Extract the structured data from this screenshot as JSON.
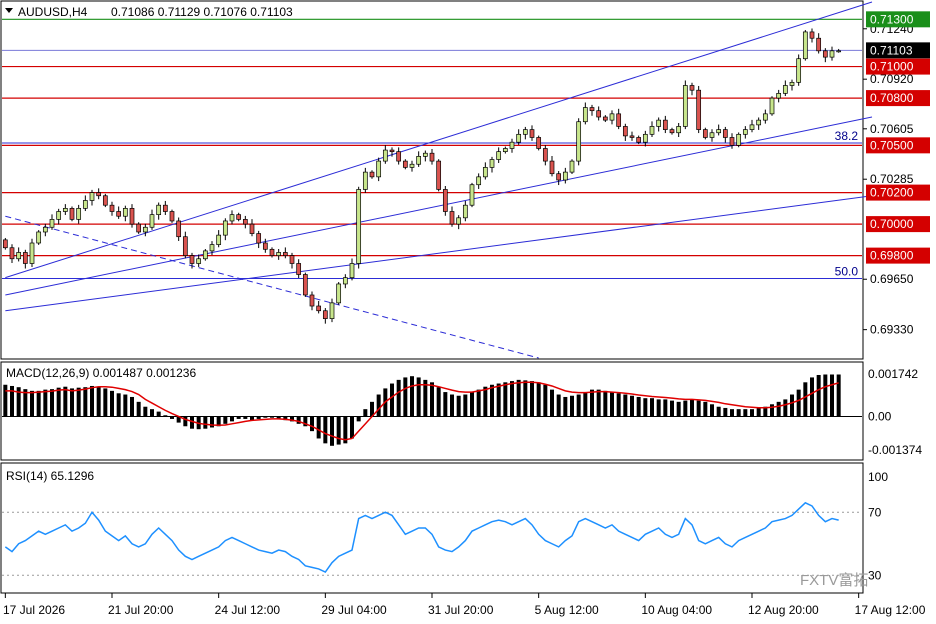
{
  "header": {
    "symbol": "AUDUSD,H4",
    "ohlc": "0.71086 0.71129 0.71076 0.71103"
  },
  "watermark": "FXTV富拓",
  "colors": {
    "background": "#ffffff",
    "axis": "#000000",
    "bull_candle": "#c8e68c",
    "bear_candle": "#d9534f",
    "wick": "#000000",
    "resistance_line": "#d40000",
    "top_line": "#1a8f1a",
    "channel_line": "#2c2cd6",
    "macd_hist": "#000000",
    "macd_signal": "#e00000",
    "rsi_line": "#1e90ff",
    "current_price_box": "#000000"
  },
  "chart_data": [
    {
      "type": "candlestick",
      "pane": "price",
      "ylim": [
        0.6915,
        0.7141
      ],
      "price_axis_labels": [
        "0.71240",
        "0.70920",
        "0.70605",
        "0.70285",
        "0.69650",
        "0.69330"
      ],
      "price_axis_values": [
        0.7124,
        0.7092,
        0.70605,
        0.70285,
        0.6965,
        0.6933
      ],
      "horizontal_levels": [
        {
          "label": "0.71300",
          "value": 0.713,
          "color": "#1a8f1a"
        },
        {
          "label": "0.71000",
          "value": 0.71,
          "color": "#d40000"
        },
        {
          "label": "0.70800",
          "value": 0.708,
          "color": "#d40000"
        },
        {
          "label": "0.70500",
          "value": 0.705,
          "color": "#d40000"
        },
        {
          "label": "0.70200",
          "value": 0.702,
          "color": "#d40000"
        },
        {
          "label": "0.70000",
          "value": 0.7,
          "color": "#d40000"
        },
        {
          "label": "0.69800",
          "value": 0.698,
          "color": "#d40000"
        }
      ],
      "fib_levels": [
        {
          "label": "38.2",
          "value": 0.70515
        },
        {
          "label": "50.0",
          "value": 0.69655
        }
      ],
      "current_price": {
        "label": "0.71103",
        "value": 0.71103
      },
      "x_axis_labels": [
        "17 Jul 2026",
        "21 Jul 20:00",
        "24 Jul 12:00",
        "29 Jul 04:00",
        "31 Jul 20:00",
        "5 Aug 12:00",
        "10 Aug 04:00",
        "12 Aug 20:00",
        "17 Aug 12:00"
      ],
      "x_axis_bar_index": [
        0,
        16,
        32,
        48,
        64,
        80,
        96,
        112,
        128
      ],
      "trendlines": [
        {
          "style": "solid",
          "from": [
            0,
            0.6966
          ],
          "to": [
            130,
            0.7141
          ]
        },
        {
          "style": "solid",
          "from": [
            0,
            0.6955
          ],
          "to": [
            130,
            0.7068
          ]
        },
        {
          "style": "solid",
          "from": [
            0,
            0.6945
          ],
          "to": [
            130,
            0.7018
          ]
        },
        {
          "style": "dashed",
          "from": [
            0,
            0.7005
          ],
          "to": [
            80,
            0.6915
          ]
        }
      ],
      "close": [
        0.6985,
        0.6978,
        0.6982,
        0.6975,
        0.6988,
        0.6995,
        0.6998,
        0.7003,
        0.7008,
        0.701,
        0.7003,
        0.701,
        0.7015,
        0.702,
        0.7018,
        0.7012,
        0.7008,
        0.7005,
        0.701,
        0.7,
        0.6995,
        0.6998,
        0.7006,
        0.7012,
        0.7008,
        0.7002,
        0.6992,
        0.698,
        0.6975,
        0.6978,
        0.6983,
        0.6987,
        0.6993,
        0.7002,
        0.7006,
        0.7003,
        0.7,
        0.6994,
        0.6988,
        0.6984,
        0.698,
        0.6982,
        0.698,
        0.6975,
        0.6968,
        0.6955,
        0.6948,
        0.6945,
        0.694,
        0.695,
        0.6962,
        0.6966,
        0.6975,
        0.7022,
        0.7033,
        0.703,
        0.704,
        0.7047,
        0.7046,
        0.704,
        0.7036,
        0.7038,
        0.7043,
        0.7045,
        0.704,
        0.7022,
        0.7008,
        0.7,
        0.7004,
        0.7012,
        0.7025,
        0.703,
        0.7036,
        0.7041,
        0.7046,
        0.7048,
        0.7052,
        0.7057,
        0.706,
        0.7055,
        0.7048,
        0.704,
        0.7032,
        0.7028,
        0.7033,
        0.704,
        0.7065,
        0.7074,
        0.7072,
        0.7068,
        0.7066,
        0.707,
        0.7062,
        0.7056,
        0.7055,
        0.7052,
        0.7057,
        0.7062,
        0.7066,
        0.706,
        0.7058,
        0.7062,
        0.7088,
        0.7085,
        0.706,
        0.7055,
        0.7058,
        0.706,
        0.7055,
        0.705,
        0.7057,
        0.706,
        0.7063,
        0.7066,
        0.707,
        0.708,
        0.7083,
        0.7088,
        0.709,
        0.7105,
        0.7122,
        0.7118,
        0.711,
        0.7106,
        0.711,
        0.711
      ],
      "open": [
        0.699,
        0.6985,
        0.6978,
        0.6982,
        0.6975,
        0.6988,
        0.6995,
        0.6998,
        0.7003,
        0.7008,
        0.701,
        0.7003,
        0.701,
        0.7015,
        0.702,
        0.7018,
        0.7012,
        0.7008,
        0.7005,
        0.701,
        0.7,
        0.6995,
        0.6998,
        0.7006,
        0.7012,
        0.7008,
        0.7002,
        0.6992,
        0.698,
        0.6975,
        0.6978,
        0.6983,
        0.6987,
        0.6993,
        0.7002,
        0.7006,
        0.7003,
        0.7,
        0.6994,
        0.6988,
        0.6984,
        0.698,
        0.6982,
        0.698,
        0.6975,
        0.6968,
        0.6955,
        0.6948,
        0.6945,
        0.694,
        0.695,
        0.6962,
        0.6966,
        0.6975,
        0.7022,
        0.7033,
        0.703,
        0.704,
        0.7047,
        0.7046,
        0.704,
        0.7036,
        0.7038,
        0.7043,
        0.7045,
        0.704,
        0.7022,
        0.7008,
        0.7,
        0.7004,
        0.7012,
        0.7025,
        0.703,
        0.7036,
        0.7041,
        0.7046,
        0.7048,
        0.7052,
        0.7057,
        0.706,
        0.7055,
        0.7048,
        0.704,
        0.7032,
        0.7028,
        0.7033,
        0.704,
        0.7065,
        0.7074,
        0.7072,
        0.7068,
        0.7066,
        0.707,
        0.7062,
        0.7056,
        0.7055,
        0.7052,
        0.7057,
        0.7062,
        0.7066,
        0.706,
        0.7058,
        0.7062,
        0.7088,
        0.7085,
        0.706,
        0.7055,
        0.7058,
        0.706,
        0.7055,
        0.705,
        0.7057,
        0.706,
        0.7063,
        0.7066,
        0.707,
        0.708,
        0.7083,
        0.7088,
        0.709,
        0.7105,
        0.7122,
        0.7118,
        0.711,
        0.7106,
        0.711
      ]
    },
    {
      "type": "macd",
      "pane": "macd",
      "label": "MACD(12,26,9) 0.001487 0.001236",
      "ylim": [
        -0.0017,
        0.00215
      ],
      "axis_labels": [
        "0.001742",
        "0.00",
        "-0.001374"
      ],
      "axis_values": [
        0.001742,
        0.0,
        -0.001374
      ],
      "histogram": [
        0.0013,
        0.00125,
        0.0012,
        0.00112,
        0.00105,
        0.00105,
        0.0011,
        0.00112,
        0.00118,
        0.00122,
        0.00115,
        0.00118,
        0.0012,
        0.00125,
        0.00122,
        0.00115,
        0.00105,
        0.00095,
        0.0009,
        0.0008,
        0.0006,
        0.0004,
        0.0003,
        0.0002,
        5e-05,
        -0.0001,
        -0.00025,
        -0.0004,
        -0.0005,
        -0.00052,
        -0.0005,
        -0.00045,
        -0.0004,
        -0.0003,
        -0.0002,
        -0.0001,
        -0.0001,
        -0.00015,
        -0.0001,
        -5e-05,
        -5e-05,
        -0.0001,
        -0.00015,
        -0.0002,
        -0.0003,
        -0.0004,
        -0.0006,
        -0.0009,
        -0.0011,
        -0.0012,
        -0.00115,
        -0.0011,
        -0.0009,
        -0.0002,
        0.0003,
        0.0006,
        0.0009,
        0.00115,
        0.00135,
        0.0015,
        0.0016,
        0.00165,
        0.0016,
        0.0015,
        0.0014,
        0.0012,
        0.001,
        0.0009,
        0.00085,
        0.0009,
        0.001,
        0.0011,
        0.00122,
        0.0013,
        0.00135,
        0.0014,
        0.00145,
        0.0015,
        0.00148,
        0.00145,
        0.0014,
        0.0013,
        0.0011,
        0.0009,
        0.0008,
        0.00085,
        0.0009,
        0.001,
        0.0011,
        0.0011,
        0.00105,
        0.001,
        0.00095,
        0.0009,
        0.00085,
        0.0008,
        0.00075,
        0.00075,
        0.0007,
        0.0007,
        0.00065,
        0.0006,
        0.00065,
        0.0007,
        0.00065,
        0.0006,
        0.0005,
        0.0004,
        0.00035,
        0.0003,
        0.0003,
        0.0003,
        0.0003,
        0.00035,
        0.0004,
        0.0005,
        0.0006,
        0.0007,
        0.0009,
        0.0011,
        0.0014,
        0.0016,
        0.0017,
        0.00172,
        0.00172,
        0.00172
      ],
      "signal": [
        0.00105,
        0.00105,
        0.001,
        0.00098,
        0.00098,
        0.001,
        0.00102,
        0.00104,
        0.00108,
        0.0011,
        0.00105,
        0.00108,
        0.00112,
        0.00118,
        0.00122,
        0.00122,
        0.0012,
        0.00115,
        0.0011,
        0.00102,
        0.0009,
        0.0007,
        0.00055,
        0.0004,
        0.00025,
        0.00012,
        0.0,
        -0.00012,
        -0.0002,
        -0.00028,
        -0.00032,
        -0.00035,
        -0.00036,
        -0.00035,
        -0.0003,
        -0.00025,
        -0.0002,
        -0.00016,
        -0.00014,
        -0.00012,
        -0.0001,
        -0.0001,
        -0.00012,
        -0.00015,
        -0.0002,
        -0.0003,
        -0.0004,
        -0.00055,
        -0.0007,
        -0.0008,
        -0.0009,
        -0.00095,
        -0.0009,
        -0.0006,
        -0.0003,
        0.0,
        0.0003,
        0.0006,
        0.0008,
        0.001,
        0.00115,
        0.00125,
        0.0013,
        0.0013,
        0.00128,
        0.00122,
        0.00115,
        0.00108,
        0.00102,
        0.001,
        0.001,
        0.00105,
        0.0011,
        0.00118,
        0.00124,
        0.0013,
        0.00135,
        0.00138,
        0.0014,
        0.0014,
        0.00138,
        0.00132,
        0.00125,
        0.00115,
        0.00105,
        0.001,
        0.00098,
        0.00098,
        0.001,
        0.00102,
        0.00102,
        0.001,
        0.00098,
        0.00095,
        0.00092,
        0.00088,
        0.00085,
        0.00082,
        0.0008,
        0.00078,
        0.00075,
        0.00072,
        0.0007,
        0.0007,
        0.00068,
        0.00066,
        0.00062,
        0.00058,
        0.00052,
        0.00048,
        0.00044,
        0.0004,
        0.00038,
        0.00036,
        0.00036,
        0.00038,
        0.00042,
        0.00048,
        0.00056,
        0.00066,
        0.0008,
        0.00095,
        0.0011,
        0.00122,
        0.0013,
        0.00138
      ]
    },
    {
      "type": "line",
      "pane": "rsi",
      "label": "RSI(14) 65.1296",
      "ylim": [
        20,
        100
      ],
      "axis_labels": [
        "100",
        "70",
        "30"
      ],
      "axis_values": [
        100,
        70,
        30
      ],
      "values": [
        48,
        45,
        50,
        52,
        55,
        58,
        56,
        58,
        60,
        62,
        58,
        60,
        63,
        70,
        65,
        58,
        55,
        52,
        55,
        50,
        48,
        50,
        56,
        60,
        56,
        52,
        46,
        42,
        40,
        42,
        44,
        46,
        48,
        52,
        54,
        52,
        50,
        48,
        46,
        45,
        44,
        46,
        45,
        42,
        40,
        36,
        35,
        34,
        32,
        38,
        42,
        44,
        46,
        66,
        68,
        66,
        68,
        70,
        68,
        62,
        56,
        58,
        60,
        60,
        56,
        48,
        46,
        45,
        48,
        52,
        58,
        60,
        62,
        64,
        65,
        64,
        62,
        64,
        66,
        62,
        56,
        52,
        50,
        48,
        52,
        55,
        64,
        66,
        64,
        62,
        60,
        62,
        58,
        56,
        54,
        52,
        56,
        58,
        60,
        56,
        54,
        56,
        66,
        62,
        52,
        50,
        52,
        54,
        50,
        48,
        52,
        54,
        56,
        58,
        60,
        64,
        65,
        66,
        68,
        72,
        76,
        74,
        68,
        64,
        66,
        65
      ]
    }
  ]
}
